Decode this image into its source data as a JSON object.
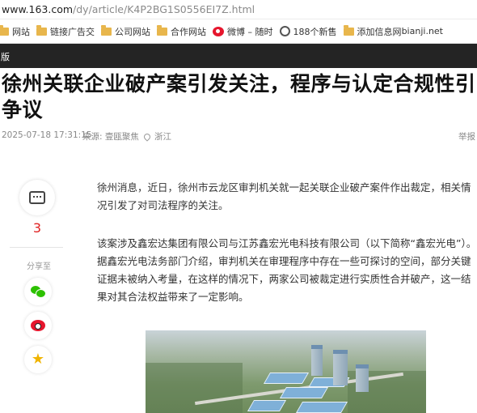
{
  "browser": {
    "url_host": "www.163.com",
    "url_path": "/dy/article/K4P2BG1S0556EI7Z.html",
    "bookmarks": [
      {
        "label": "网站",
        "icon": "folder-icon"
      },
      {
        "label": "链接广告交",
        "icon": "folder-icon"
      },
      {
        "label": "公司网站",
        "icon": "folder-icon"
      },
      {
        "label": "合作网站",
        "icon": "folder-icon"
      },
      {
        "label": "微博 – 随时",
        "icon": "weibo-icon"
      },
      {
        "label": "188个新售",
        "icon": "globe-icon"
      },
      {
        "label": "添加信息网",
        "icon": "folder-icon"
      }
    ],
    "bookmark_right": "bianji.net"
  },
  "navbar": {
    "label": "版"
  },
  "article": {
    "title": "徐州关联企业破产案引发关注，程序与认定合规性引争议",
    "date": "2025-07-18 17:31:15",
    "source": "来源: 壹瓯聚焦",
    "location": "浙江",
    "report": "举报",
    "paragraphs": [
      "徐州消息，近日，徐州市云龙区审判机关就一起关联企业破产案件作出裁定，相关情况引发了对司法程序的关注。",
      "该案涉及鑫宏达集团有限公司与江苏鑫宏光电科技有限公司（以下简称“鑫宏光电”）。据鑫宏光电法务部门介绍，审判机关在审理程序中存在一些可探讨的空间，部分关键证据未被纳入考量，在这样的情况下，两家公司被裁定进行实质性合并破产，这一结果对其合法权益带来了一定影响。"
    ]
  },
  "sidebar": {
    "comment_count": "3",
    "share_label": "分享至"
  },
  "colors": {
    "navbar_bg": "#242424",
    "comment_count": "#e02020",
    "wechat": "#2dc100",
    "weibo": "#e6162d",
    "favorite": "#f0b400"
  }
}
